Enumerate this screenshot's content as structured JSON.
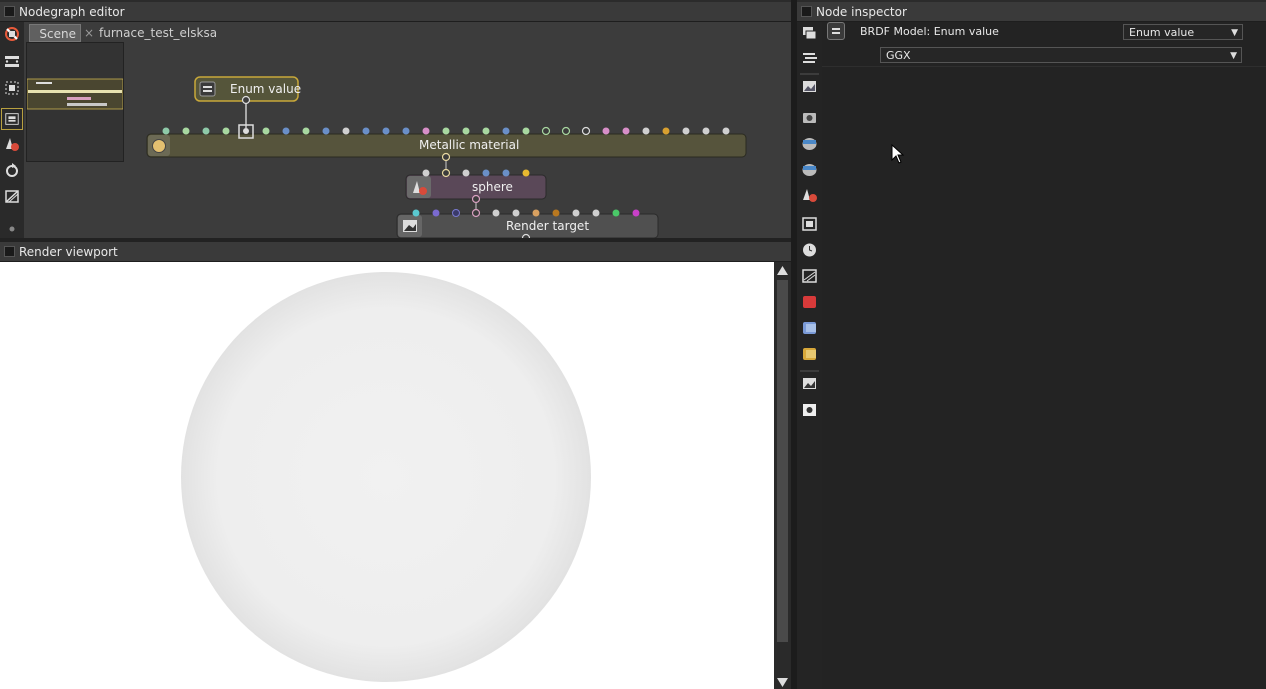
{
  "nodegraph": {
    "title": "Nodegraph editor",
    "tabs": [
      {
        "label": "Scene"
      },
      {
        "label": "furnace_test_elsksa"
      }
    ],
    "close_glyph": "×",
    "nodes": {
      "enum": {
        "label": "Enum value",
        "icon": "enum-icon"
      },
      "metallic": {
        "label": "Metallic material",
        "icon": "material-ball-icon"
      },
      "sphere": {
        "label": "sphere",
        "icon": "geometry-icon"
      },
      "render_target": {
        "label": "Render target",
        "icon": "image-icon"
      }
    },
    "toolbar_icons": [
      "unlink-nodes-icon",
      "fit-nodes-icon",
      "fit-selection-icon",
      "recenter-icon",
      "geometry-icon",
      "refresh-icon",
      "clear-icon",
      "dot-icon"
    ]
  },
  "render_viewport": {
    "title": "Render viewport"
  },
  "inspector": {
    "title": "Node inspector",
    "row_label": "BRDF Model: Enum value",
    "type_dropdown": "Enum value",
    "value_dropdown": "GGX",
    "toolbar_icons": [
      "node-stack-icon",
      "list-icon",
      "image-icon",
      "camera-icon",
      "environment-icon",
      "texture-environment-icon",
      "geometry-icon",
      "film-icon",
      "clock-icon",
      "kernel-icon",
      "red-cube-icon",
      "blue-cube-icon",
      "yellow-cube-icon",
      "imager-icon",
      "postprocess-icon"
    ]
  }
}
